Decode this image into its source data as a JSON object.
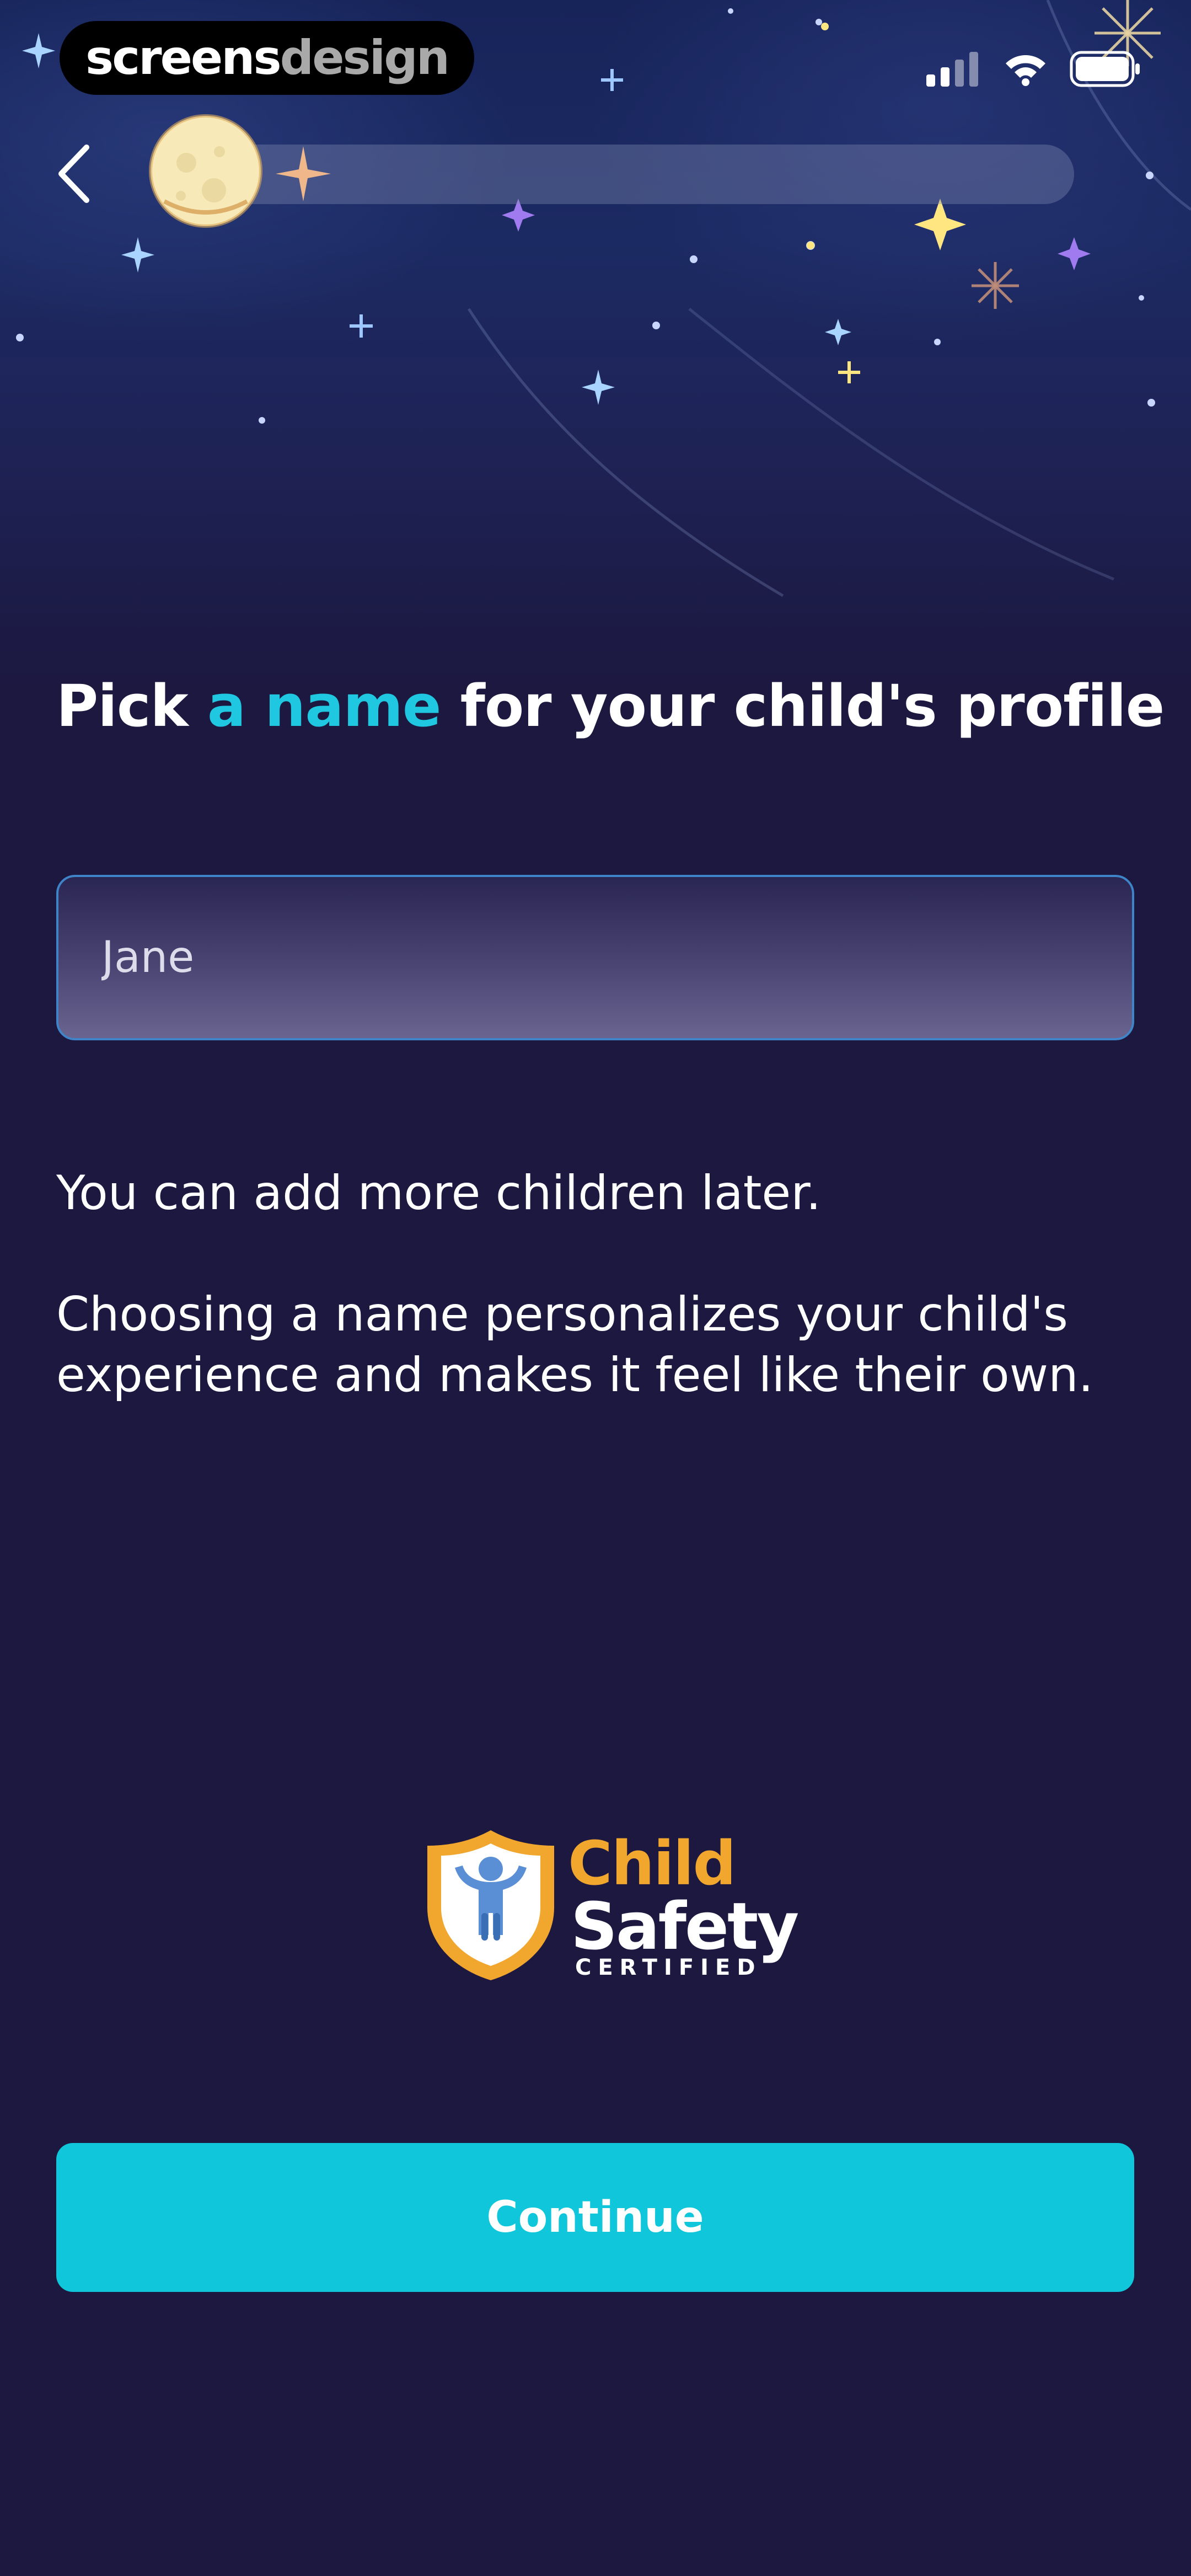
{
  "watermark": {
    "part1": "screens",
    "part2": "design"
  },
  "status_bar": {
    "icons": [
      "cellular-signal-icon",
      "wifi-icon",
      "battery-icon"
    ]
  },
  "navigation": {
    "back_icon": "chevron-left-icon",
    "progress_icon": "moon-icon",
    "progress_fraction": 0.05
  },
  "heading": {
    "before": "Pick ",
    "accent": "a name",
    "after": " for your child's profile"
  },
  "name_input": {
    "value": "Jane"
  },
  "info": {
    "line1": "You can add more children later.",
    "line2": "Choosing a name personalizes your child's experience and makes it feel like their own."
  },
  "badge": {
    "word1": "Child",
    "word2": "Safety",
    "word3": "CERTIFIED"
  },
  "actions": {
    "continue_label": "Continue"
  },
  "colors": {
    "accent": "#1fc8e0",
    "button": "#10c6da",
    "background": "#1c1840",
    "badge_orange": "#f1a62e"
  }
}
